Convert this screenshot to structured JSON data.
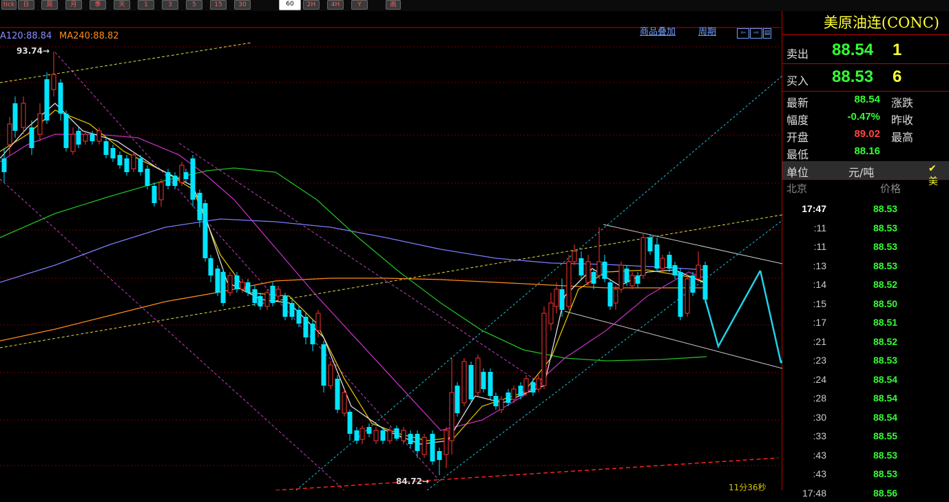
{
  "toolbar": {
    "buttons": [
      "tick",
      "日",
      "周",
      "月",
      "季",
      "天",
      "1",
      "3",
      "5",
      "15",
      "30",
      "60",
      "2H",
      "4H",
      "Y",
      "画"
    ],
    "selected": "60"
  },
  "chart": {
    "ma_labels": [
      {
        "text": "A120:88.84",
        "color": "#8b8bff"
      },
      {
        "text": "MA240:88.82",
        "color": "#ff8c1a"
      }
    ],
    "top_links": [
      "商品叠加",
      "周期"
    ],
    "nav_icons": [
      "back-icon",
      "forward-icon",
      "panel-icon"
    ],
    "high_label": "93.74",
    "low_label": "84.72",
    "timer": "11分36秒",
    "colors": {
      "up": "#ff3333",
      "down": "#00e5ff",
      "grid": "#7a0000"
    }
  },
  "panel": {
    "title": "美原油连(CONC)",
    "ask": {
      "label": "卖出",
      "price": "88.54",
      "volume": "1"
    },
    "bid": {
      "label": "买入",
      "price": "88.53",
      "volume": "6"
    },
    "fields": [
      {
        "label": "最新",
        "value": "88.54",
        "color": "#33ff33",
        "label2": "涨跌"
      },
      {
        "label": "幅度",
        "value": "-0.47%",
        "color": "#33ff33",
        "label2": "昨收"
      },
      {
        "label": "开盘",
        "value": "89.02",
        "color": "#ff4444",
        "label2": "最高"
      },
      {
        "label": "最低",
        "value": "88.16",
        "color": "#33ff33",
        "label2": ""
      }
    ],
    "unit": {
      "label": "单位",
      "value": "元/吨",
      "checkbox": "✔ 美"
    },
    "tick_header": {
      "time": "北京",
      "price": "价格"
    },
    "ticks": [
      {
        "time": "17:47",
        "price": "88.53"
      },
      {
        "time": ":11",
        "price": "88.53"
      },
      {
        "time": ":11",
        "price": "88.53"
      },
      {
        "time": ":13",
        "price": "88.53"
      },
      {
        "time": ":14",
        "price": "88.52"
      },
      {
        "time": ":15",
        "price": "88.50"
      },
      {
        "time": ":17",
        "price": "88.51"
      },
      {
        "time": ":21",
        "price": "88.52"
      },
      {
        "time": ":23",
        "price": "88.53"
      },
      {
        "time": ":24",
        "price": "88.54"
      },
      {
        "time": ":28",
        "price": "88.54"
      },
      {
        "time": ":30",
        "price": "88.54"
      },
      {
        "time": ":33",
        "price": "88.55"
      },
      {
        "time": ":43",
        "price": "88.53"
      },
      {
        "time": ":43",
        "price": "88.53"
      },
      {
        "time": "17:48",
        "price": "88.56"
      }
    ]
  }
}
